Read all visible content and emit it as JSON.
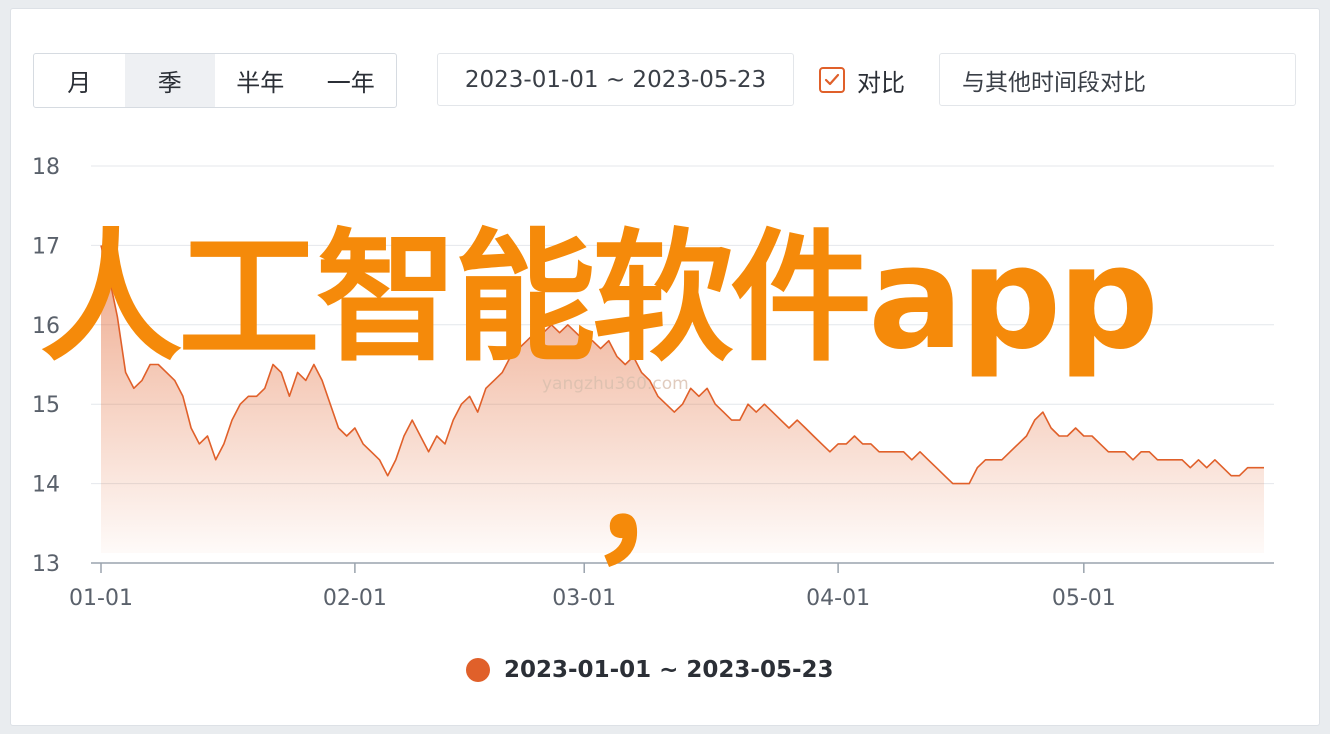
{
  "period_tabs": [
    {
      "label": "月",
      "active": false
    },
    {
      "label": "季",
      "active": true
    },
    {
      "label": "半年",
      "active": false
    },
    {
      "label": "一年",
      "active": false
    }
  ],
  "date_range": "2023-01-01 ~ 2023-05-23",
  "compare": {
    "label": "对比",
    "checked": true,
    "placeholder": "与其他时间段对比"
  },
  "overlay": {
    "title": "人工智能软件app",
    "comma": "，",
    "watermark": "yangzhu360.com"
  },
  "colors": {
    "accent": "#e0602a",
    "overlay": "#f58a0a"
  },
  "chart_data": {
    "type": "area",
    "ylim": [
      13,
      18
    ],
    "yticks": [
      "13",
      "14",
      "15",
      "16",
      "17",
      "18"
    ],
    "xticks": [
      {
        "label": "01-01",
        "day": 0
      },
      {
        "label": "02-01",
        "day": 31
      },
      {
        "label": "03-01",
        "day": 59
      },
      {
        "label": "04-01",
        "day": 90
      },
      {
        "label": "05-01",
        "day": 120
      }
    ],
    "x_max_day": 142,
    "series": [
      {
        "name": "2023-01-01 ~ 2023-05-23",
        "points": [
          [
            0,
            17.0
          ],
          [
            1,
            16.6
          ],
          [
            2,
            16.1
          ],
          [
            3,
            15.4
          ],
          [
            4,
            15.2
          ],
          [
            5,
            15.3
          ],
          [
            6,
            15.5
          ],
          [
            7,
            15.5
          ],
          [
            8,
            15.4
          ],
          [
            9,
            15.3
          ],
          [
            10,
            15.1
          ],
          [
            11,
            14.7
          ],
          [
            12,
            14.5
          ],
          [
            13,
            14.6
          ],
          [
            14,
            14.3
          ],
          [
            15,
            14.5
          ],
          [
            16,
            14.8
          ],
          [
            17,
            15.0
          ],
          [
            18,
            15.1
          ],
          [
            19,
            15.1
          ],
          [
            20,
            15.2
          ],
          [
            21,
            15.5
          ],
          [
            22,
            15.4
          ],
          [
            23,
            15.1
          ],
          [
            24,
            15.4
          ],
          [
            25,
            15.3
          ],
          [
            26,
            15.5
          ],
          [
            27,
            15.3
          ],
          [
            28,
            15.0
          ],
          [
            29,
            14.7
          ],
          [
            30,
            14.6
          ],
          [
            31,
            14.7
          ],
          [
            32,
            14.5
          ],
          [
            33,
            14.4
          ],
          [
            34,
            14.3
          ],
          [
            35,
            14.1
          ],
          [
            36,
            14.3
          ],
          [
            37,
            14.6
          ],
          [
            38,
            14.8
          ],
          [
            39,
            14.6
          ],
          [
            40,
            14.4
          ],
          [
            41,
            14.6
          ],
          [
            42,
            14.5
          ],
          [
            43,
            14.8
          ],
          [
            44,
            15.0
          ],
          [
            45,
            15.1
          ],
          [
            46,
            14.9
          ],
          [
            47,
            15.2
          ],
          [
            48,
            15.3
          ],
          [
            49,
            15.4
          ],
          [
            50,
            15.6
          ],
          [
            51,
            15.7
          ],
          [
            52,
            15.8
          ],
          [
            53,
            15.9
          ],
          [
            54,
            15.9
          ],
          [
            55,
            16.0
          ],
          [
            56,
            15.9
          ],
          [
            57,
            16.0
          ],
          [
            58,
            15.9
          ],
          [
            59,
            15.8
          ],
          [
            60,
            15.8
          ],
          [
            61,
            15.7
          ],
          [
            62,
            15.8
          ],
          [
            63,
            15.6
          ],
          [
            64,
            15.5
          ],
          [
            65,
            15.6
          ],
          [
            66,
            15.4
          ],
          [
            67,
            15.3
          ],
          [
            68,
            15.1
          ],
          [
            69,
            15.0
          ],
          [
            70,
            14.9
          ],
          [
            71,
            15.0
          ],
          [
            72,
            15.2
          ],
          [
            73,
            15.1
          ],
          [
            74,
            15.2
          ],
          [
            75,
            15.0
          ],
          [
            76,
            14.9
          ],
          [
            77,
            14.8
          ],
          [
            78,
            14.8
          ],
          [
            79,
            15.0
          ],
          [
            80,
            14.9
          ],
          [
            81,
            15.0
          ],
          [
            82,
            14.9
          ],
          [
            83,
            14.8
          ],
          [
            84,
            14.7
          ],
          [
            85,
            14.8
          ],
          [
            86,
            14.7
          ],
          [
            87,
            14.6
          ],
          [
            88,
            14.5
          ],
          [
            89,
            14.4
          ],
          [
            90,
            14.5
          ],
          [
            91,
            14.5
          ],
          [
            92,
            14.6
          ],
          [
            93,
            14.5
          ],
          [
            94,
            14.5
          ],
          [
            95,
            14.4
          ],
          [
            96,
            14.4
          ],
          [
            97,
            14.4
          ],
          [
            98,
            14.4
          ],
          [
            99,
            14.3
          ],
          [
            100,
            14.4
          ],
          [
            101,
            14.3
          ],
          [
            102,
            14.2
          ],
          [
            103,
            14.1
          ],
          [
            104,
            14.0
          ],
          [
            105,
            14.0
          ],
          [
            106,
            14.0
          ],
          [
            107,
            14.2
          ],
          [
            108,
            14.3
          ],
          [
            109,
            14.3
          ],
          [
            110,
            14.3
          ],
          [
            111,
            14.4
          ],
          [
            112,
            14.5
          ],
          [
            113,
            14.6
          ],
          [
            114,
            14.8
          ],
          [
            115,
            14.9
          ],
          [
            116,
            14.7
          ],
          [
            117,
            14.6
          ],
          [
            118,
            14.6
          ],
          [
            119,
            14.7
          ],
          [
            120,
            14.6
          ],
          [
            121,
            14.6
          ],
          [
            122,
            14.5
          ],
          [
            123,
            14.4
          ],
          [
            124,
            14.4
          ],
          [
            125,
            14.4
          ],
          [
            126,
            14.3
          ],
          [
            127,
            14.4
          ],
          [
            128,
            14.4
          ],
          [
            129,
            14.3
          ],
          [
            130,
            14.3
          ],
          [
            131,
            14.3
          ],
          [
            132,
            14.3
          ],
          [
            133,
            14.2
          ],
          [
            134,
            14.3
          ],
          [
            135,
            14.2
          ],
          [
            136,
            14.3
          ],
          [
            137,
            14.2
          ],
          [
            138,
            14.1
          ],
          [
            139,
            14.1
          ],
          [
            140,
            14.2
          ],
          [
            141,
            14.2
          ],
          [
            142,
            14.2
          ]
        ]
      }
    ],
    "legend_position": "bottom",
    "grid": true
  }
}
